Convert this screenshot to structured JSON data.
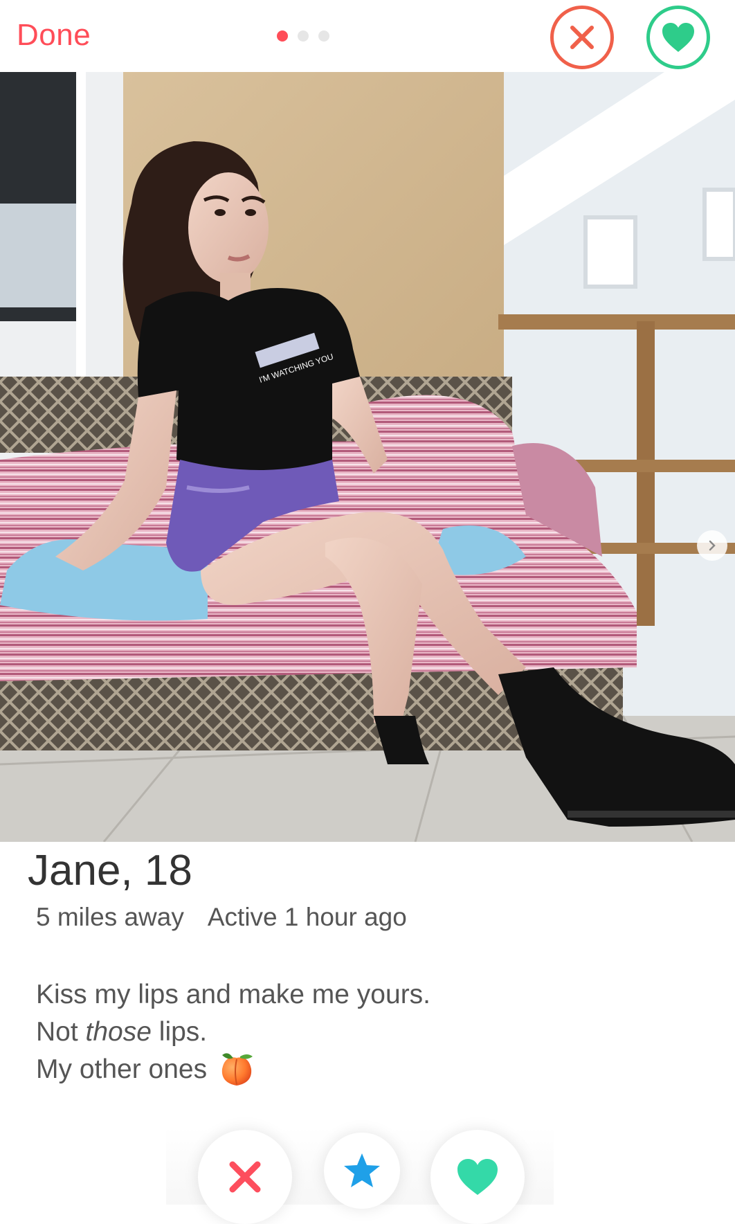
{
  "header": {
    "done_label": "Done",
    "photo_count": 3,
    "active_photo_index": 0,
    "nope_icon": "close-icon",
    "like_icon": "heart-icon",
    "colors": {
      "accent": "#ff4d58",
      "nope": "#f0604a",
      "like": "#2ecc8a"
    }
  },
  "profile": {
    "name": "Jane,",
    "age": "18",
    "distance": "5 miles away",
    "activity": "Active 1 hour ago",
    "bio": {
      "line1": "Kiss my lips and make me yours.",
      "line2_pre": "Not ",
      "line2_em": "those",
      "line2_post": " lips.",
      "line3": "My other ones",
      "line3_emoji": "peach-emoji"
    },
    "photo_shirt_text": "I'M WATCHING YOU"
  },
  "actions": {
    "nope_icon": "close-icon",
    "superlike_icon": "star-icon",
    "like_icon": "heart-icon",
    "colors": {
      "nope": "#fd4e5d",
      "superlike": "#1fa0e8",
      "like": "#34d9a8"
    }
  }
}
